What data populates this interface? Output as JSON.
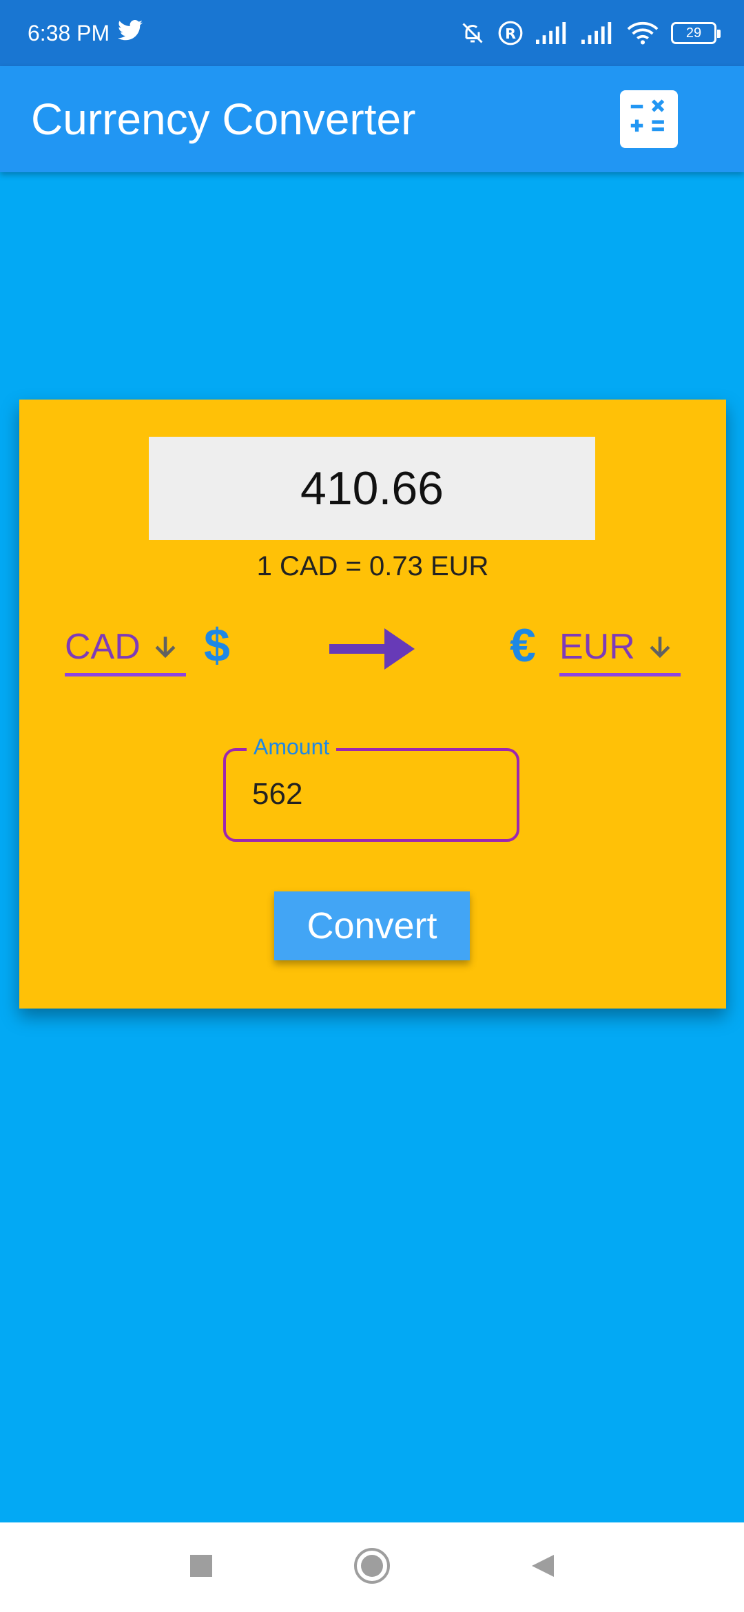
{
  "status_bar": {
    "time": "6:38 PM",
    "battery": "29",
    "icons": [
      "twitter-icon",
      "bell-off-icon",
      "registered-icon",
      "signal-icon",
      "signal-icon",
      "wifi-icon",
      "battery-icon"
    ]
  },
  "app_bar": {
    "title": "Currency Converter",
    "action_icon": "calculator-icon"
  },
  "converter": {
    "result": "410.66",
    "rate_text": "1 CAD = 0.73 EUR",
    "from_currency": "CAD",
    "from_symbol": "$",
    "to_currency": "EUR",
    "to_symbol": "€",
    "amount_label": "Amount",
    "amount_value": "562",
    "convert_label": "Convert"
  },
  "nav_bar": {
    "icons": [
      "recents-square-icon",
      "home-circle-icon",
      "back-triangle-icon"
    ]
  },
  "colors": {
    "background": "#03A9F4",
    "app_bar": "#2196F3",
    "status_bar": "#1976D2",
    "card": "#FFC107",
    "accent_purple": "#7E3BB8",
    "button": "#42A5F5"
  }
}
